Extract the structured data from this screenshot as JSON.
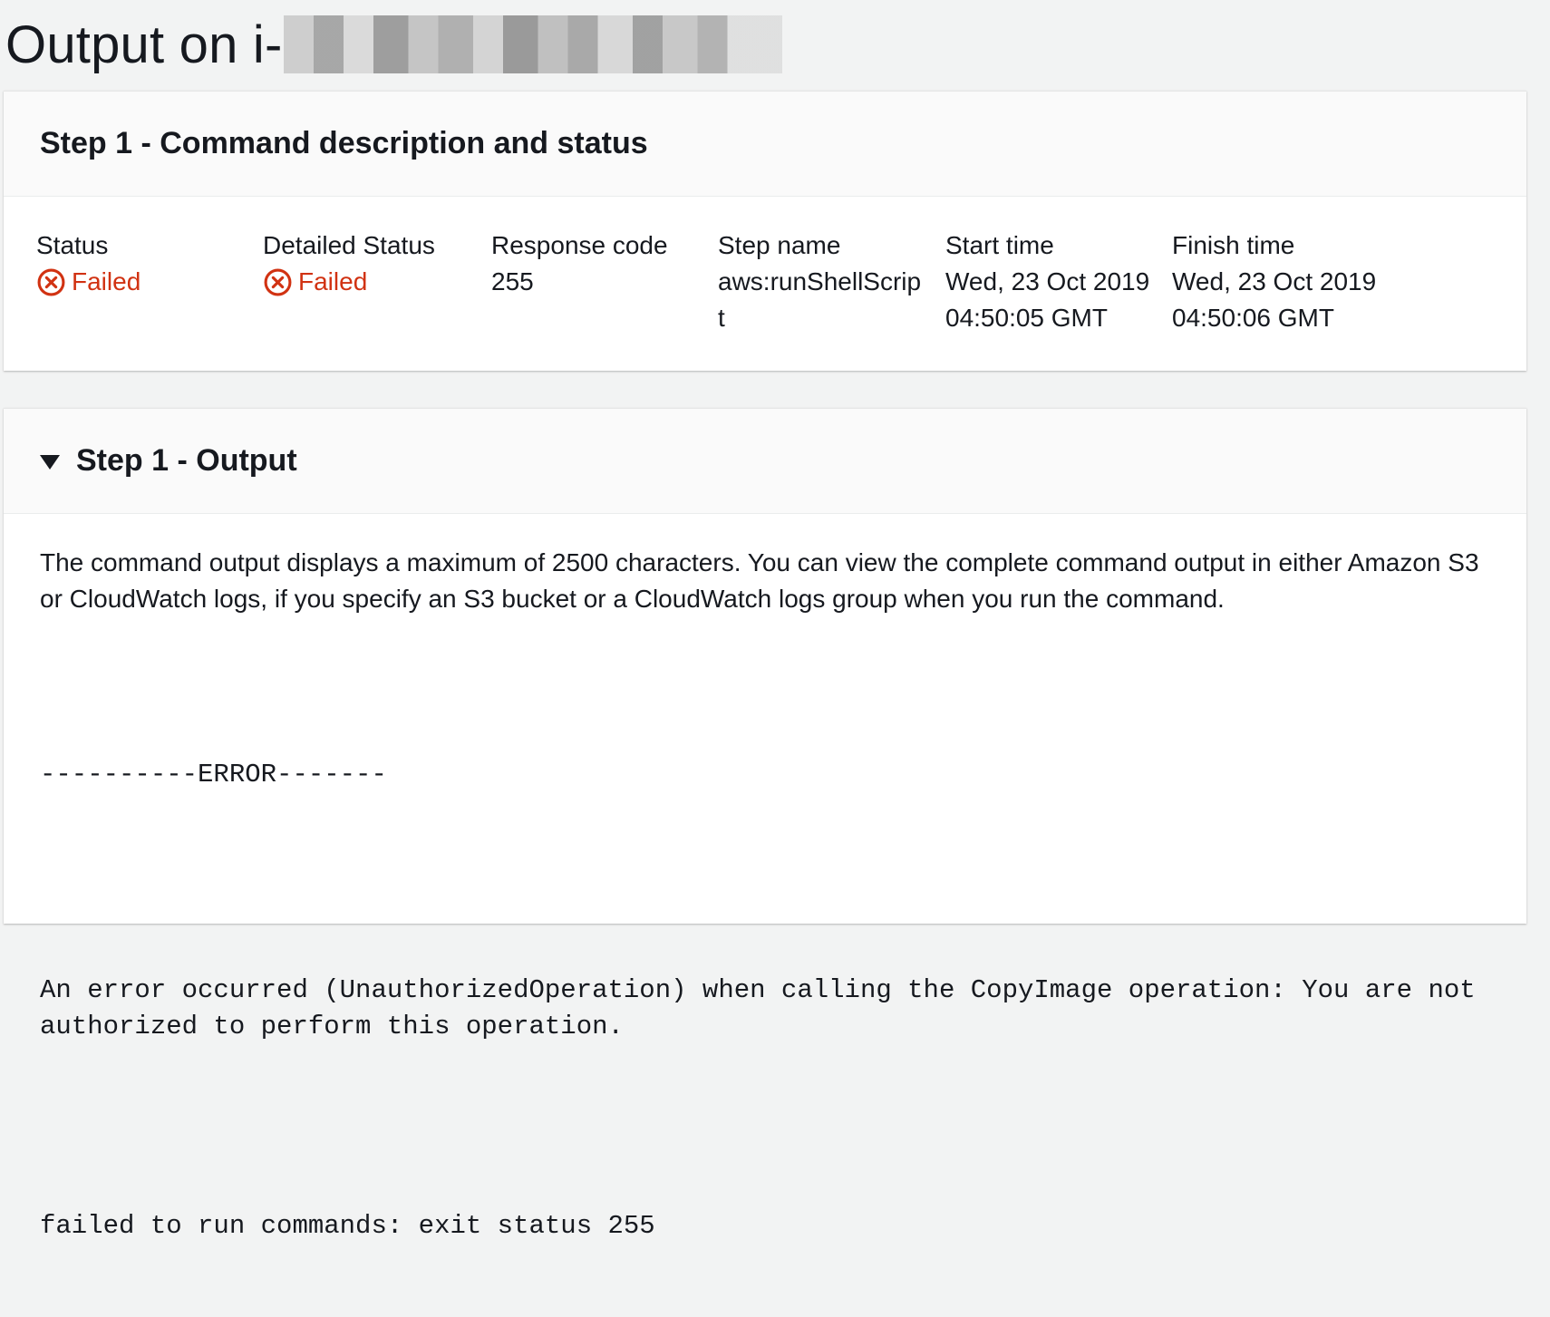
{
  "page": {
    "title_prefix": "Output on i-",
    "instance_id_redacted": true
  },
  "step_status_panel": {
    "title": "Step 1 - Command description and status",
    "fields": {
      "status_label": "Status",
      "status_value": "Failed",
      "detailed_status_label": "Detailed Status",
      "detailed_status_value": "Failed",
      "response_code_label": "Response code",
      "response_code_value": "255",
      "step_name_label": "Step name",
      "step_name_value": "aws:runShellScript",
      "start_time_label": "Start time",
      "start_time_value": "Wed, 23 Oct 2019 04:50:05 GMT",
      "finish_time_label": "Finish time",
      "finish_time_value": "Wed, 23 Oct 2019 04:50:06 GMT"
    }
  },
  "output_panel": {
    "title": "Step 1 - Output",
    "expanded": true,
    "note": "The command output displays a maximum of 2500 characters. You can view the complete command output in either Amazon S3 or CloudWatch logs, if you specify an S3 bucket or a CloudWatch logs group when you run the command.",
    "output_lines": {
      "error_header": "----------ERROR-------",
      "error_message": "An error occurred (UnauthorizedOperation) when calling the CopyImage operation: You are not authorized to perform this operation.",
      "exit_message": "failed to run commands: exit status 255"
    }
  },
  "colors": {
    "background": "#f2f3f3",
    "panel": "#ffffff",
    "panel_header": "#fafafa",
    "failed": "#d13212",
    "text": "#16191f"
  },
  "icons": {
    "failed": "x-circle-icon",
    "collapse": "caret-down-icon"
  }
}
